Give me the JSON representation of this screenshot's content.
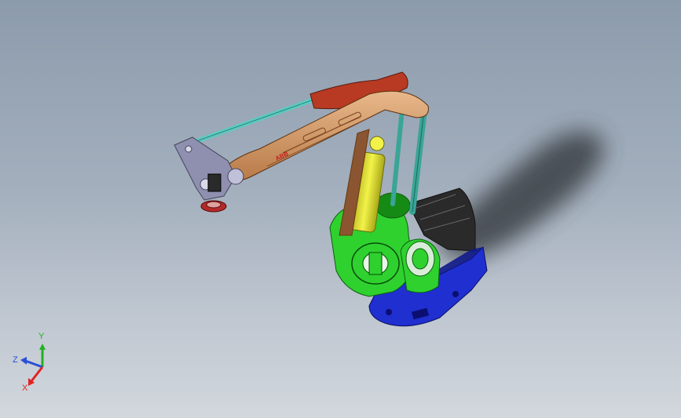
{
  "viewport": {
    "background_top": "#8c9bac",
    "background_bottom": "#d2d7dd"
  },
  "robot": {
    "brand_label": "ABB",
    "colors": {
      "base": "#1f2fd0",
      "base_dark": "#101a8a",
      "rotary": "#2fd12f",
      "rotary_dark": "#158a15",
      "cylinder": "#e2e22a",
      "main_arm": "#d9a070",
      "main_arm_dark": "#8a5530",
      "link_top": "#b83a22",
      "rod": "#5fc9c0",
      "parallel_bar": "#3aa596",
      "wrist": "#8f90b0",
      "gearbox": "#2a2a2a",
      "flange": "#b22a2a",
      "shadow": "#3a3f45"
    }
  },
  "triad": {
    "axis_y": "Y",
    "axis_z": "Z",
    "axis_x": "X",
    "color_x": "#e02424",
    "color_y": "#22b022",
    "color_z": "#2a4ed6"
  }
}
